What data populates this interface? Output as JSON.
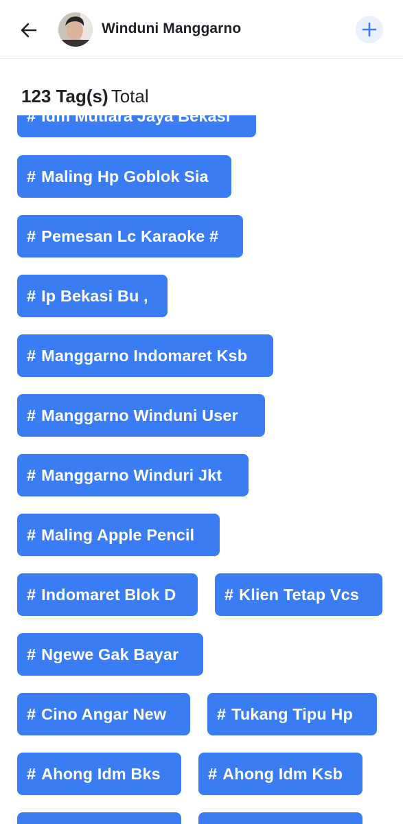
{
  "header": {
    "back_icon": "arrow-left-icon",
    "username": "Winduni Manggarno",
    "add_icon": "plus-icon",
    "accent": "#3a7cf4"
  },
  "summary": {
    "count_label": "123 Tag(s)",
    "total_label": "Total"
  },
  "tags": [
    "Idm Mutiara Jaya Bekasi",
    "Maling Hp Goblok Sia",
    "Pemesan Lc Karaoke #",
    "Ip Bekasi Bu ,",
    "Manggarno Indomaret Ksb",
    "Manggarno Winduni User",
    "Manggarno Winduri Jkt",
    "Maling Apple Pencil",
    "Indomaret Blok D",
    "Klien Tetap Vcs",
    "Ngewe Gak Bayar",
    "Cino Angar New",
    "Tukang Tipu Hp",
    "Ahong Idm Bks",
    "Ahong Idm Ksb",
    "",
    ""
  ],
  "tag_prefix": "#"
}
